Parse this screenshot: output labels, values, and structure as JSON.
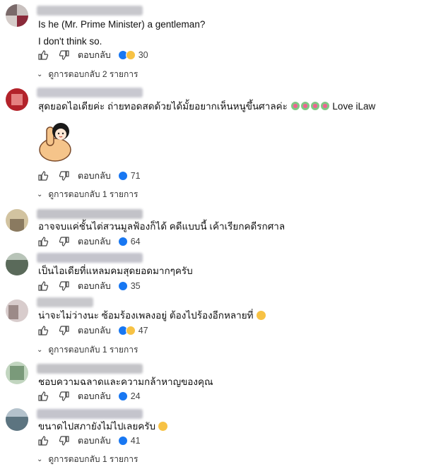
{
  "ui": {
    "reply_label": "ตอบกลับ"
  },
  "comments": [
    {
      "lines": [
        "Is he (Mr. Prime Minister) a gentleman?",
        "I don't think so."
      ],
      "reactions": "30",
      "replies_label": "ดูการตอบกลับ 2 รายการ",
      "avatar_colors": [
        "#7a6a6a",
        "#c9c1bf"
      ],
      "name_color": "#c7c7cc"
    },
    {
      "lines": [
        "สุดยอดไอเดียค่ะ ถ่ายทอดสดด้วยได้มั้ยอยากเห็นหนูขึ้นศาลค่ะ",
        "Love iLaw"
      ],
      "reactions": "71",
      "replies_label": "ดูการตอบกลับ 1 รายการ",
      "avatar_colors": [
        "#b3222a",
        "#e48080"
      ],
      "name_color": "#c8c8d0"
    },
    {
      "lines": [
        "อาจจบแค่ชั้นไต่สวนมูลฟ้องก็ได้ คดีแบบนี้ เค้าเรียกคดีรกศาล"
      ],
      "reactions": "64",
      "avatar_colors": [
        "#8a7a60",
        "#d2c3a0"
      ],
      "name_color": "#c2c2c8"
    },
    {
      "lines": [
        "เป็นไอเดียที่แหลมคมสุดยอดมากๆครับ"
      ],
      "reactions": "35",
      "avatar_colors": [
        "#5a6a5a",
        "#b8c4b8"
      ],
      "name_color": "#c4c4cc"
    },
    {
      "lines": [
        "น่าจะไม่ว่างนะ ซ้อมร้องเพลงอยู่ ต้องไปร้องอีกหลายที่"
      ],
      "reactions": "47",
      "replies_label": "ดูการตอบกลับ 1 รายการ",
      "avatar_colors": [
        "#9c8a88",
        "#d8cccc"
      ],
      "name_color": "#c8c8cc"
    },
    {
      "lines": [
        "ชอบความฉลาดและความกล้าหาญของคุณ"
      ],
      "reactions": "24",
      "avatar_colors": [
        "#7a9a7a",
        "#c2d6c0"
      ],
      "name_color": "#c4c4c8"
    },
    {
      "lines": [
        "ขนาดไปสภายังไม่ไปเลยครับ"
      ],
      "reactions": "41",
      "replies_label": "ดูการตอบกลับ 1 รายการ",
      "avatar_colors": [
        "#5c7480",
        "#b4c2cc"
      ],
      "name_color": "#c4c4cc"
    }
  ]
}
